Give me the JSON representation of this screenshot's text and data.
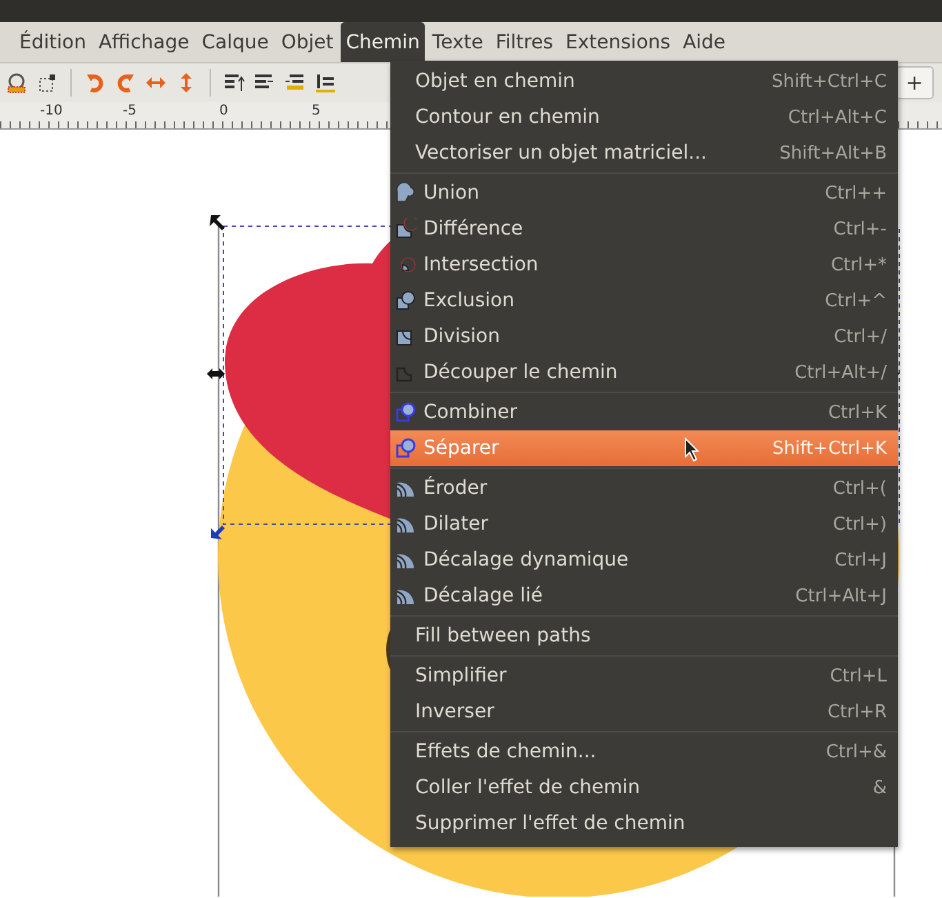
{
  "menubar": [
    {
      "label": "Édition",
      "selected": false
    },
    {
      "label": "Affichage",
      "selected": false
    },
    {
      "label": "Calque",
      "selected": false
    },
    {
      "label": "Objet",
      "selected": false
    },
    {
      "label": "Chemin",
      "selected": true
    },
    {
      "label": "Texte",
      "selected": false
    },
    {
      "label": "Filtres",
      "selected": false
    },
    {
      "label": "Extensions",
      "selected": false
    },
    {
      "label": "Aide",
      "selected": false
    }
  ],
  "toolbar": {
    "button": "+"
  },
  "ruler": {
    "labels": [
      "-10",
      "-5",
      "0",
      "5"
    ]
  },
  "menu": {
    "groups": [
      [
        {
          "label": "Objet en chemin",
          "shortcut": "Shift+Ctrl+C",
          "kind": "plain",
          "selected": false
        },
        {
          "label": "Contour en chemin",
          "shortcut": "Ctrl+Alt+C",
          "kind": "plain",
          "selected": false
        },
        {
          "label": "Vectoriser un objet matriciel...",
          "shortcut": "Shift+Alt+B",
          "kind": "plain",
          "selected": false
        }
      ],
      [
        {
          "label": "Union",
          "shortcut": "Ctrl++",
          "kind": "union",
          "selected": false
        },
        {
          "label": "Différence",
          "shortcut": "Ctrl+-",
          "kind": "difference",
          "selected": false
        },
        {
          "label": "Intersection",
          "shortcut": "Ctrl+*",
          "kind": "intersection",
          "selected": false
        },
        {
          "label": "Exclusion",
          "shortcut": "Ctrl+^",
          "kind": "exclusion",
          "selected": false
        },
        {
          "label": "Division",
          "shortcut": "Ctrl+/",
          "kind": "division",
          "selected": false
        },
        {
          "label": "Découper le chemin",
          "shortcut": "Ctrl+Alt+/",
          "kind": "cut",
          "selected": false
        }
      ],
      [
        {
          "label": "Combiner",
          "shortcut": "Ctrl+K",
          "kind": "combine",
          "selected": false
        },
        {
          "label": "Séparer",
          "shortcut": "Shift+Ctrl+K",
          "kind": "combine",
          "selected": true
        }
      ],
      [
        {
          "label": "Éroder",
          "shortcut": "Ctrl+(",
          "kind": "offset",
          "selected": false
        },
        {
          "label": "Dilater",
          "shortcut": "Ctrl+)",
          "kind": "offset",
          "selected": false
        },
        {
          "label": "Décalage dynamique",
          "shortcut": "Ctrl+J",
          "kind": "offset",
          "selected": false
        },
        {
          "label": "Décalage lié",
          "shortcut": "Ctrl+Alt+J",
          "kind": "offset",
          "selected": false
        }
      ],
      [
        {
          "label": "Fill between paths",
          "kind": "plain",
          "selected": false
        }
      ],
      [
        {
          "label": "Simplifier",
          "shortcut": "Ctrl+L",
          "kind": "plain",
          "selected": false
        },
        {
          "label": "Inverser",
          "shortcut": "Ctrl+R",
          "kind": "plain",
          "selected": false
        }
      ],
      [
        {
          "label": "Effets de chemin...",
          "shortcut": "Ctrl+&",
          "kind": "plain",
          "selected": false
        },
        {
          "label": "Coller l'effet de chemin",
          "shortcut": "&",
          "kind": "plain",
          "selected": false
        },
        {
          "label": "Supprimer l'effet de chemin",
          "kind": "plain",
          "selected": false
        }
      ]
    ]
  }
}
